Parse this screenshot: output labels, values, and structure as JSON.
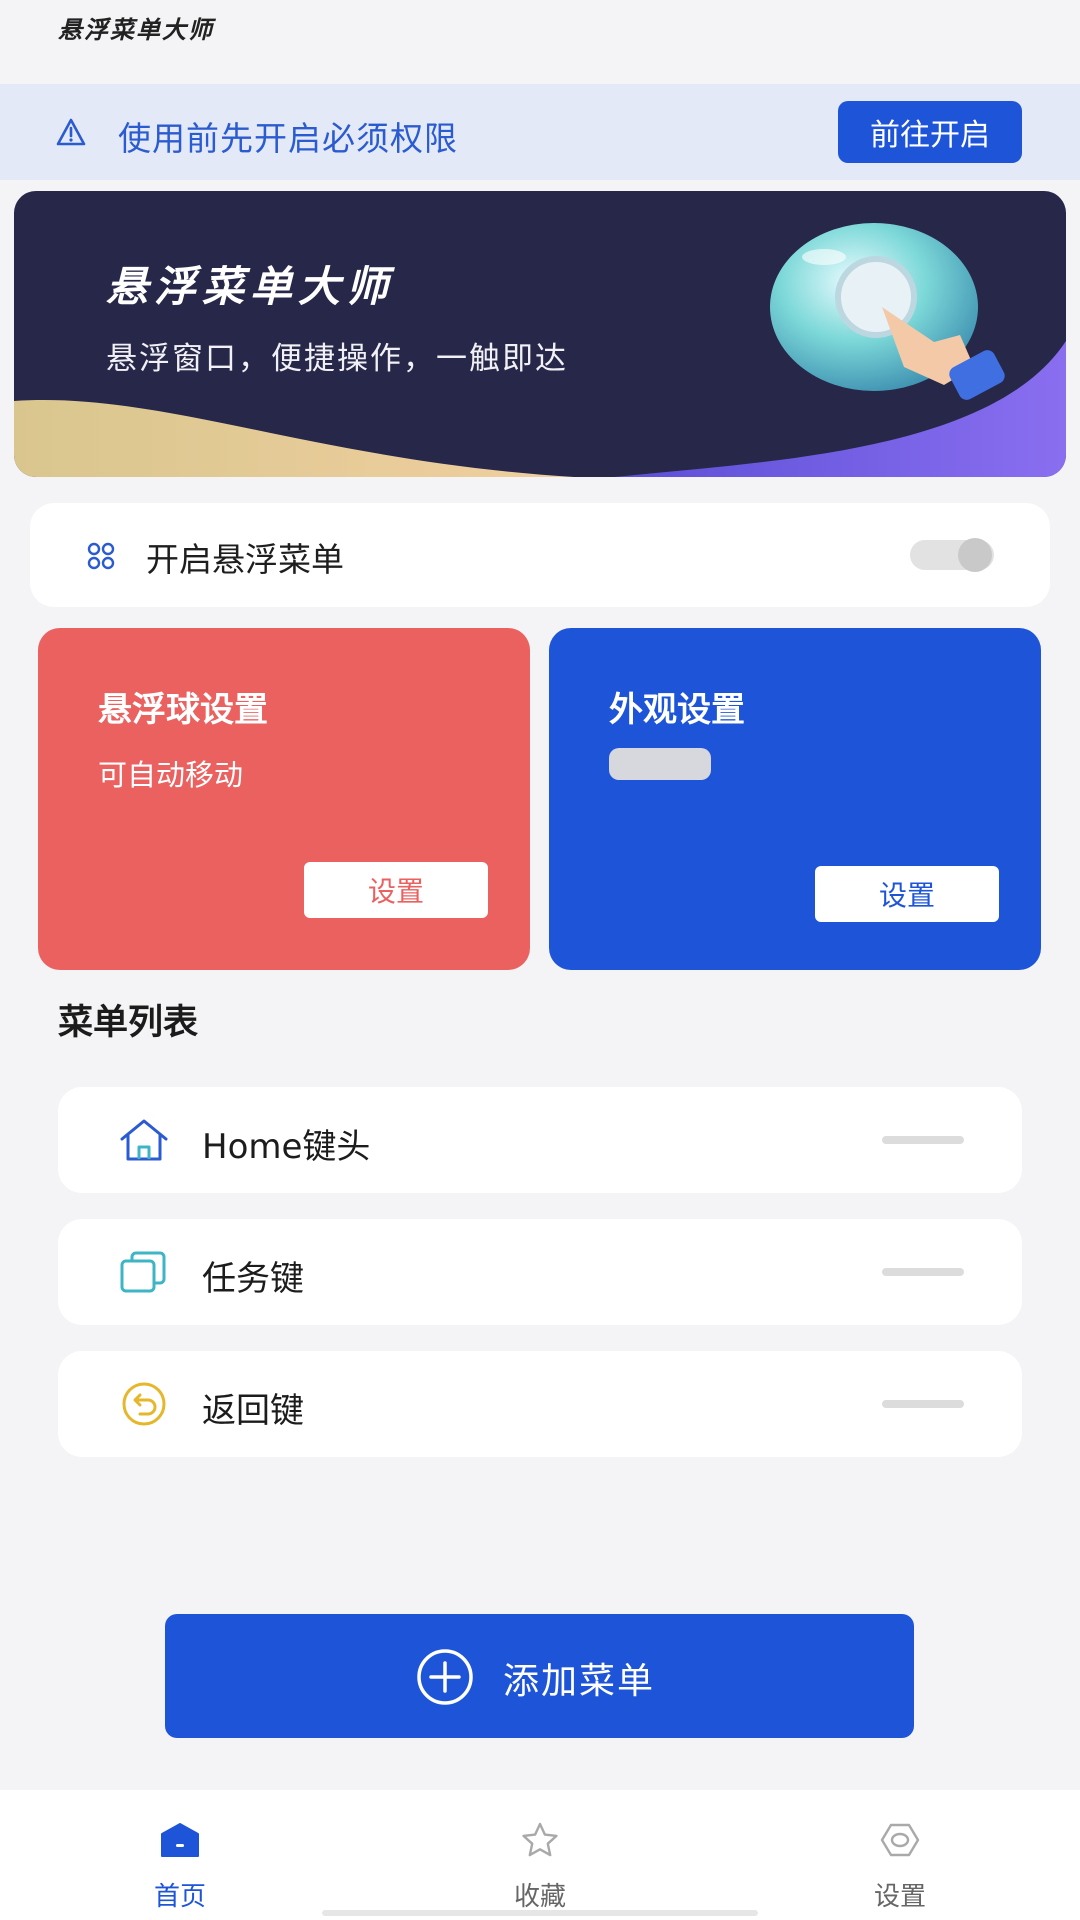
{
  "app": {
    "title": "悬浮菜单大师"
  },
  "permission_bar": {
    "icon": "warning-icon",
    "text": "使用前先开启必须权限",
    "button_label": "前往开启"
  },
  "banner": {
    "title": "悬浮菜单大师",
    "subtitle": "悬浮窗口，便捷操作，一触即达",
    "art": "touch-bubble-illustration"
  },
  "toggle": {
    "icon": "command-icon",
    "label": "开启悬浮菜单",
    "enabled": false
  },
  "cards": [
    {
      "title": "悬浮球设置",
      "subtitle": "可自动移动",
      "button_label": "设置",
      "color": "#ea6160"
    },
    {
      "title": "外观设置",
      "subtitle": "",
      "button_label": "设置",
      "color": "#1e55d8"
    }
  ],
  "menu_list": {
    "title": "菜单列表",
    "items": [
      {
        "label": "Home键头",
        "icon": "home-icon",
        "icon_color": "#2b5bd0"
      },
      {
        "label": "任务键",
        "icon": "recent-tasks-icon",
        "icon_color": "#3db5c6"
      },
      {
        "label": "返回键",
        "icon": "back-icon",
        "icon_color": "#e6b72a"
      }
    ]
  },
  "add_button": {
    "label": "添加菜单",
    "icon": "plus-circle-icon"
  },
  "tabbar": {
    "tabs": [
      {
        "label": "首页",
        "icon": "home-tab-icon",
        "active": true
      },
      {
        "label": "收藏",
        "icon": "star-icon",
        "active": false
      },
      {
        "label": "设置",
        "icon": "settings-icon",
        "active": false
      }
    ]
  },
  "colors": {
    "primary": "#1e55d8",
    "accent_red": "#ea6160",
    "banner_bg": "#262749"
  }
}
